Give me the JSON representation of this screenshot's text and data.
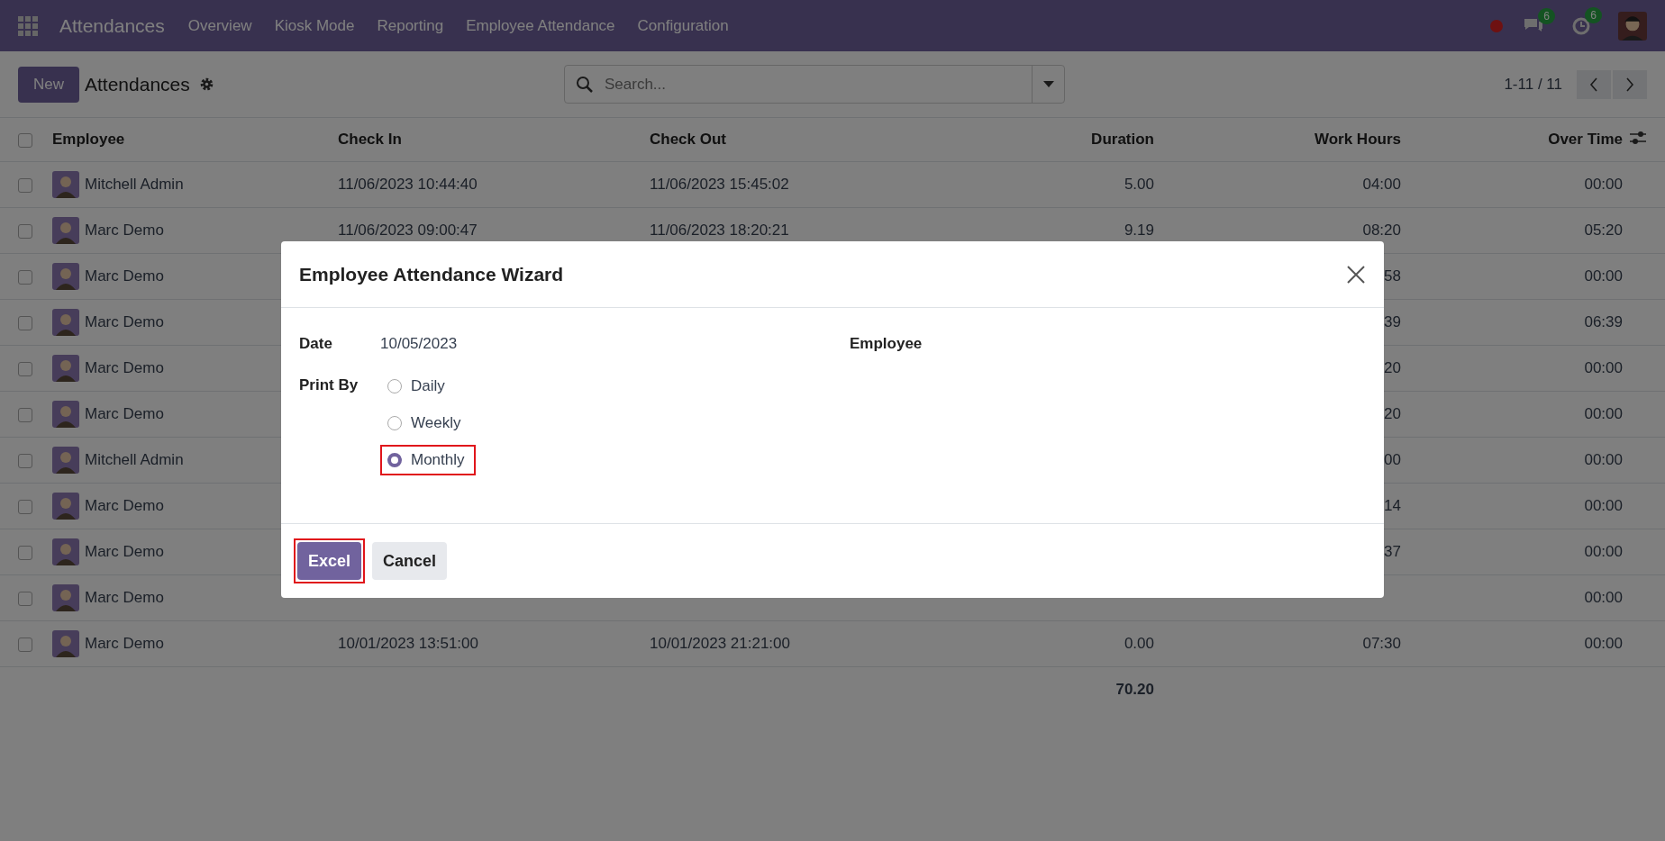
{
  "navbar": {
    "app_name": "Attendances",
    "menu": [
      "Overview",
      "Kiosk Mode",
      "Reporting",
      "Employee Attendance",
      "Configuration"
    ],
    "chat_badge": "6",
    "activity_badge": "6"
  },
  "control_panel": {
    "new_button": "New",
    "title": "Attendances",
    "search": {
      "placeholder": "Search..."
    },
    "pager": "1-11 / 11"
  },
  "table": {
    "select_all": {
      "checked": false
    },
    "columns": [
      "Employee",
      "Check In",
      "Check Out",
      "Duration",
      "Work Hours",
      "Over Time"
    ],
    "rows": [
      {
        "checked": false,
        "employee": "Mitchell Admin",
        "check_in": "11/06/2023 10:44:40",
        "check_out": "11/06/2023 15:45:02",
        "duration": "5.00",
        "work_hours": "04:00",
        "over_time": "00:00"
      },
      {
        "checked": false,
        "employee": "Marc Demo",
        "check_in": "11/06/2023 09:00:47",
        "check_out": "11/06/2023 18:20:21",
        "duration": "9.19",
        "work_hours": "08:20",
        "over_time": "05:20"
      },
      {
        "checked": false,
        "employee": "Marc Demo",
        "work_hours": "58",
        "over_time": "00:00"
      },
      {
        "checked": false,
        "employee": "Marc Demo",
        "work_hours": "39",
        "over_time": "06:39"
      },
      {
        "checked": false,
        "employee": "Marc Demo",
        "work_hours": "20",
        "over_time": "00:00"
      },
      {
        "checked": false,
        "employee": "Marc Demo",
        "work_hours": "20",
        "over_time": "00:00"
      },
      {
        "checked": false,
        "employee": "Mitchell Admin",
        "work_hours": "00",
        "over_time": "00:00"
      },
      {
        "checked": false,
        "employee": "Marc Demo",
        "work_hours": "14",
        "over_time": "00:00"
      },
      {
        "checked": false,
        "employee": "Marc Demo",
        "work_hours": "37",
        "over_time": "00:00"
      },
      {
        "checked": false,
        "employee": "Marc Demo",
        "over_time": "00:00"
      },
      {
        "checked": false,
        "employee": "Marc Demo",
        "check_in": "10/01/2023 13:51:00",
        "check_out": "10/01/2023 21:21:00",
        "duration": "0.00",
        "work_hours": "07:30",
        "over_time": "00:00"
      }
    ],
    "total_duration": "70.20"
  },
  "dialog": {
    "title": "Employee Attendance Wizard",
    "date_label": "Date",
    "date_value": "10/05/2023",
    "employee_label": "Employee",
    "print_by_label": "Print By",
    "options": [
      {
        "label": "Daily",
        "selected": false,
        "highlighted": false
      },
      {
        "label": "Weekly",
        "selected": false,
        "highlighted": false
      },
      {
        "label": "Monthly",
        "selected": true,
        "highlighted": true
      }
    ],
    "buttons": [
      {
        "label": "Excel",
        "kind": "primary",
        "highlighted": true
      },
      {
        "label": "Cancel",
        "kind": "secondary",
        "highlighted": false
      }
    ]
  }
}
